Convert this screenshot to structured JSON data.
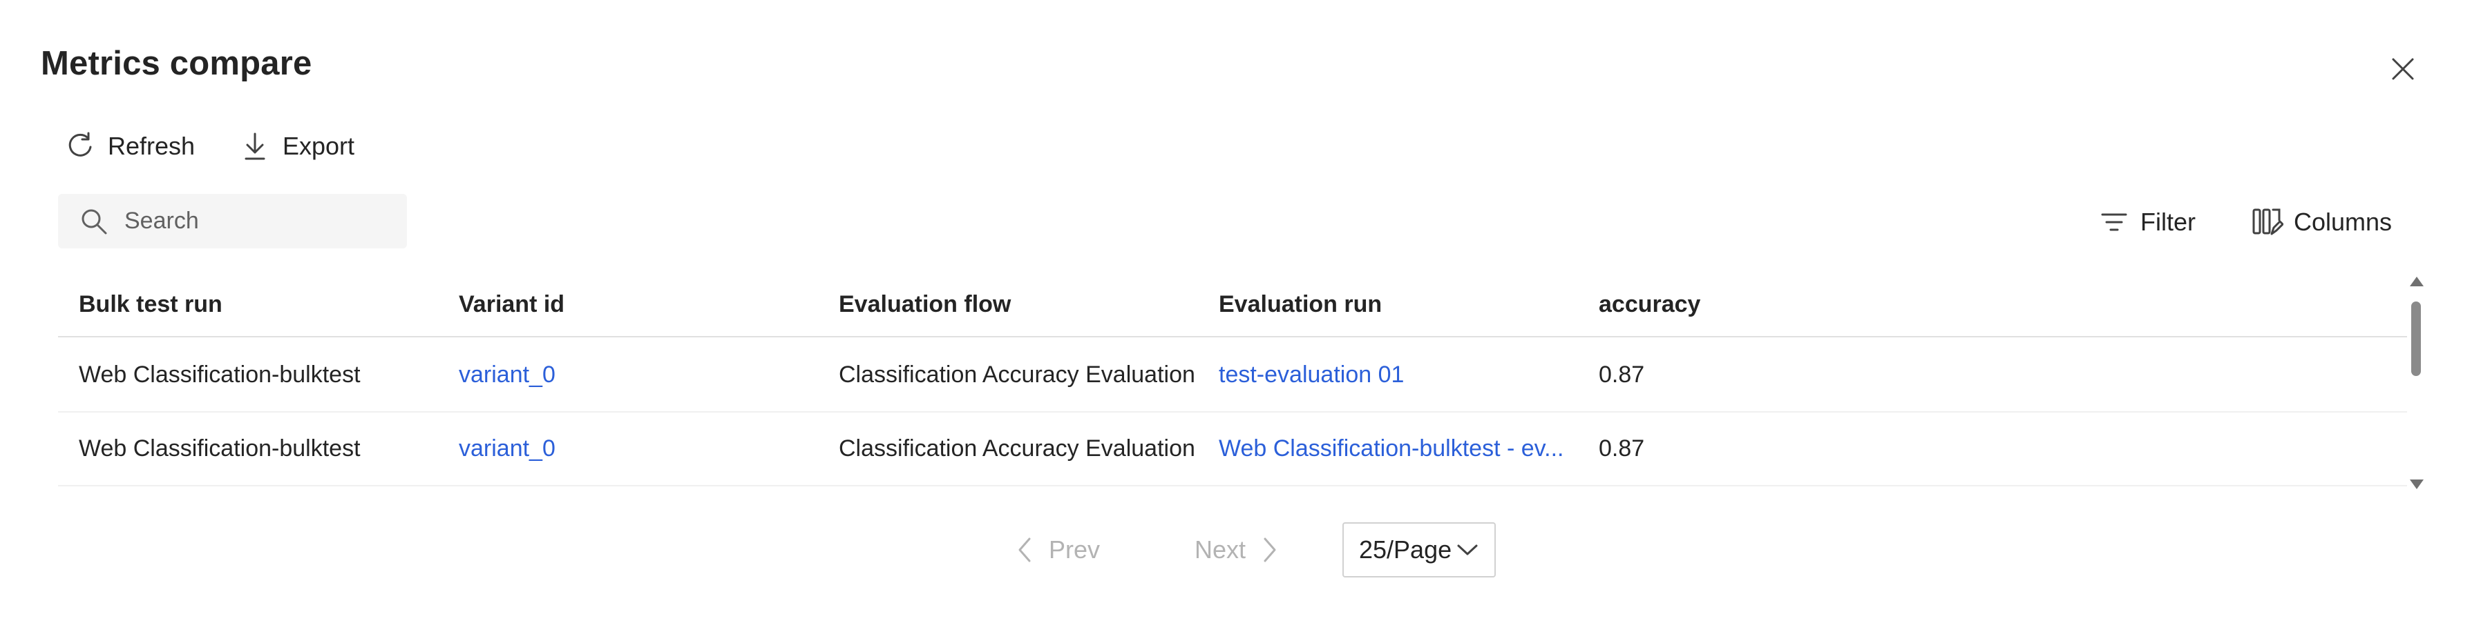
{
  "dialog": {
    "title": "Metrics compare",
    "close_icon": "close-icon"
  },
  "toolbar": {
    "refresh_label": "Refresh",
    "refresh_icon": "refresh-icon",
    "export_label": "Export",
    "export_icon": "download-icon",
    "filter_label": "Filter",
    "filter_icon": "filter-icon",
    "columns_label": "Columns",
    "columns_icon": "columns-edit-icon"
  },
  "search": {
    "placeholder": "Search",
    "value": "",
    "icon": "search-icon"
  },
  "table": {
    "columns": [
      "Bulk test run",
      "Variant id",
      "Evaluation flow",
      "Evaluation run",
      "accuracy"
    ],
    "rows": [
      {
        "bulk_test_run": "Web Classification-bulktest",
        "variant_id": "variant_0",
        "evaluation_flow": "Classification Accuracy Evaluation",
        "evaluation_run": "test-evaluation 01",
        "accuracy": "0.87"
      },
      {
        "bulk_test_run": "Web Classification-bulktest",
        "variant_id": "variant_0",
        "evaluation_flow": "Classification Accuracy Evaluation",
        "evaluation_run": "Web Classification-bulktest - ev...",
        "accuracy": "0.87"
      }
    ]
  },
  "pagination": {
    "prev_label": "Prev",
    "next_label": "Next",
    "page_size": "25/Page",
    "prev_enabled": false,
    "next_enabled": false
  },
  "colors": {
    "link": "#2b5fd9",
    "text": "#242424",
    "disabled": "#b3b3b3",
    "search_bg": "#f5f5f5"
  }
}
